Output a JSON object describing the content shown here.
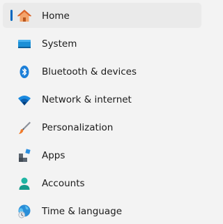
{
  "sidebar": {
    "items": [
      {
        "label": "Home",
        "icon": "home-icon",
        "selected": true
      },
      {
        "label": "System",
        "icon": "system-monitor-icon"
      },
      {
        "label": "Bluetooth & devices",
        "icon": "bluetooth-icon"
      },
      {
        "label": "Network & internet",
        "icon": "wifi-icon"
      },
      {
        "label": "Personalization",
        "icon": "paintbrush-icon"
      },
      {
        "label": "Apps",
        "icon": "apps-icon"
      },
      {
        "label": "Accounts",
        "icon": "account-icon"
      },
      {
        "label": "Time & language",
        "icon": "globe-clock-icon"
      }
    ]
  },
  "colors": {
    "accent": "#0067c0",
    "selected_bg": "#eaeaea",
    "background": "#f3f3f3"
  }
}
